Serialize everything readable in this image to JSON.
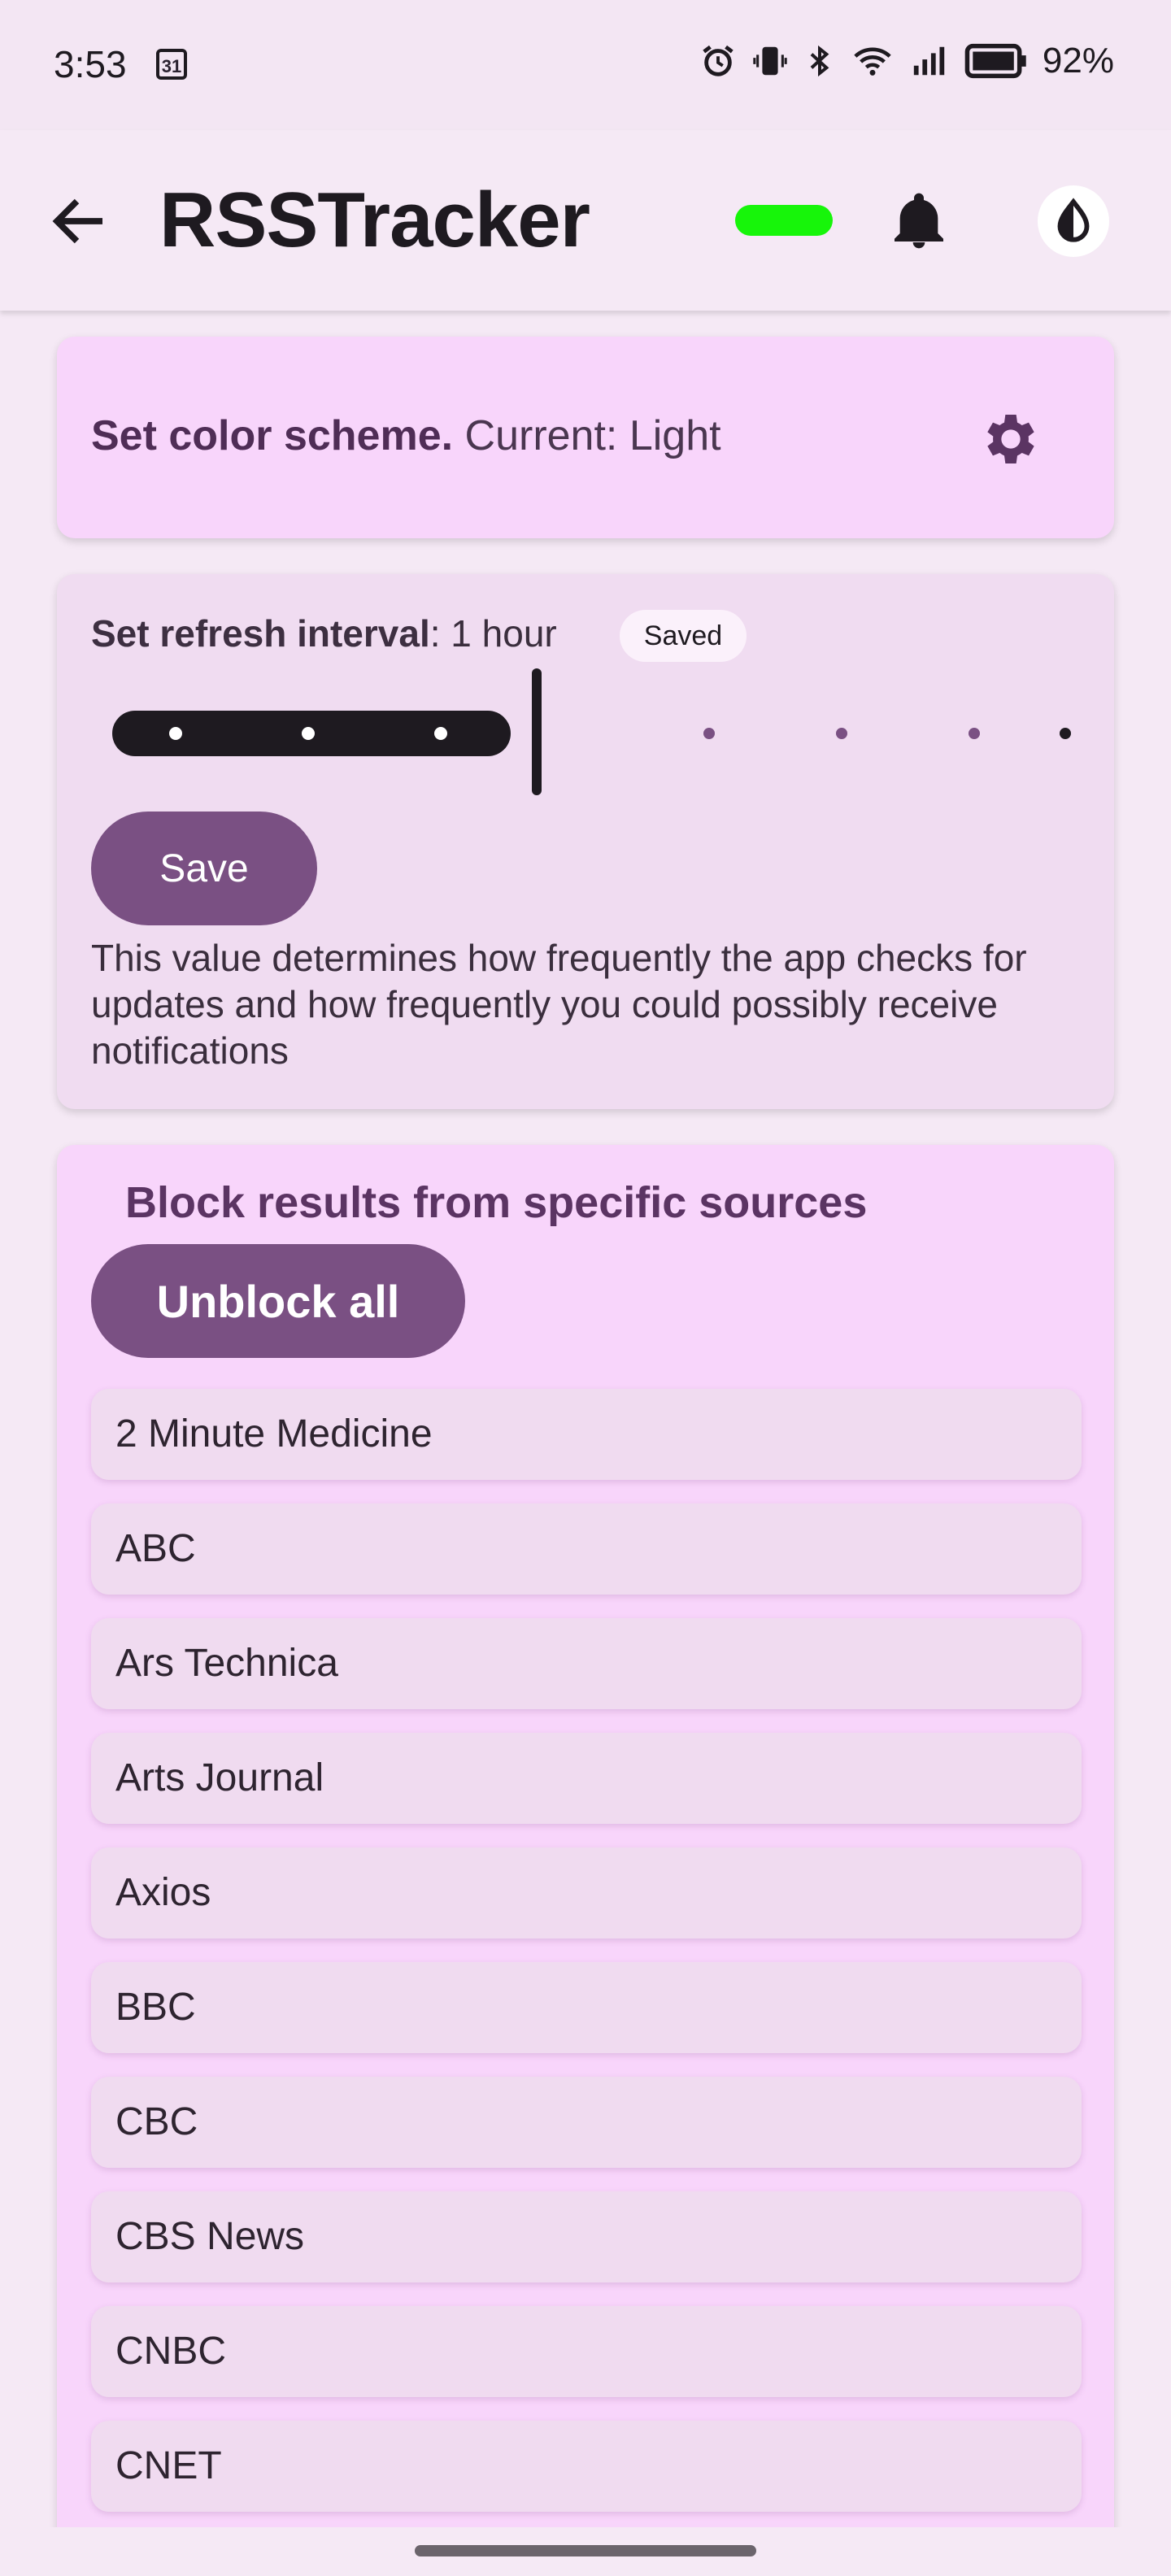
{
  "status_bar": {
    "time": "3:53",
    "calendar_day": "31",
    "battery_pct": "92%",
    "icons": [
      "alarm-icon",
      "vibrate-icon",
      "bluetooth-icon",
      "wifi-icon",
      "signal-icon",
      "battery-icon"
    ]
  },
  "app_bar": {
    "title": "RSSTracker",
    "status_color": "#17f50a",
    "icons": [
      "back-arrow-icon",
      "bell-icon",
      "contrast-icon"
    ]
  },
  "color_scheme_card": {
    "label_bold": "Set color scheme.",
    "label_rest": " Current: Light",
    "icon": "gear-icon"
  },
  "refresh_card": {
    "label_bold": "Set refresh interval",
    "label_rest": ": 1 hour",
    "chip": "Saved",
    "slider": {
      "steps": 8,
      "selected_step": 4
    },
    "save_label": "Save",
    "description": "This value determines how frequently the app checks for updates and how frequently you could possibly receive notifications"
  },
  "block_card": {
    "title": "Block results from specific sources",
    "unblock_label": "Unblock all",
    "sources": [
      "2 Minute Medicine",
      "ABC",
      "Ars Technica",
      "Arts Journal",
      "Axios",
      "BBC",
      "CBC",
      "CBS News",
      "CNBC",
      "CNET"
    ]
  },
  "colors": {
    "accent": "#7a5083",
    "card_pink": "#f8d5fb",
    "card_lilac": "#f0dcf1"
  }
}
